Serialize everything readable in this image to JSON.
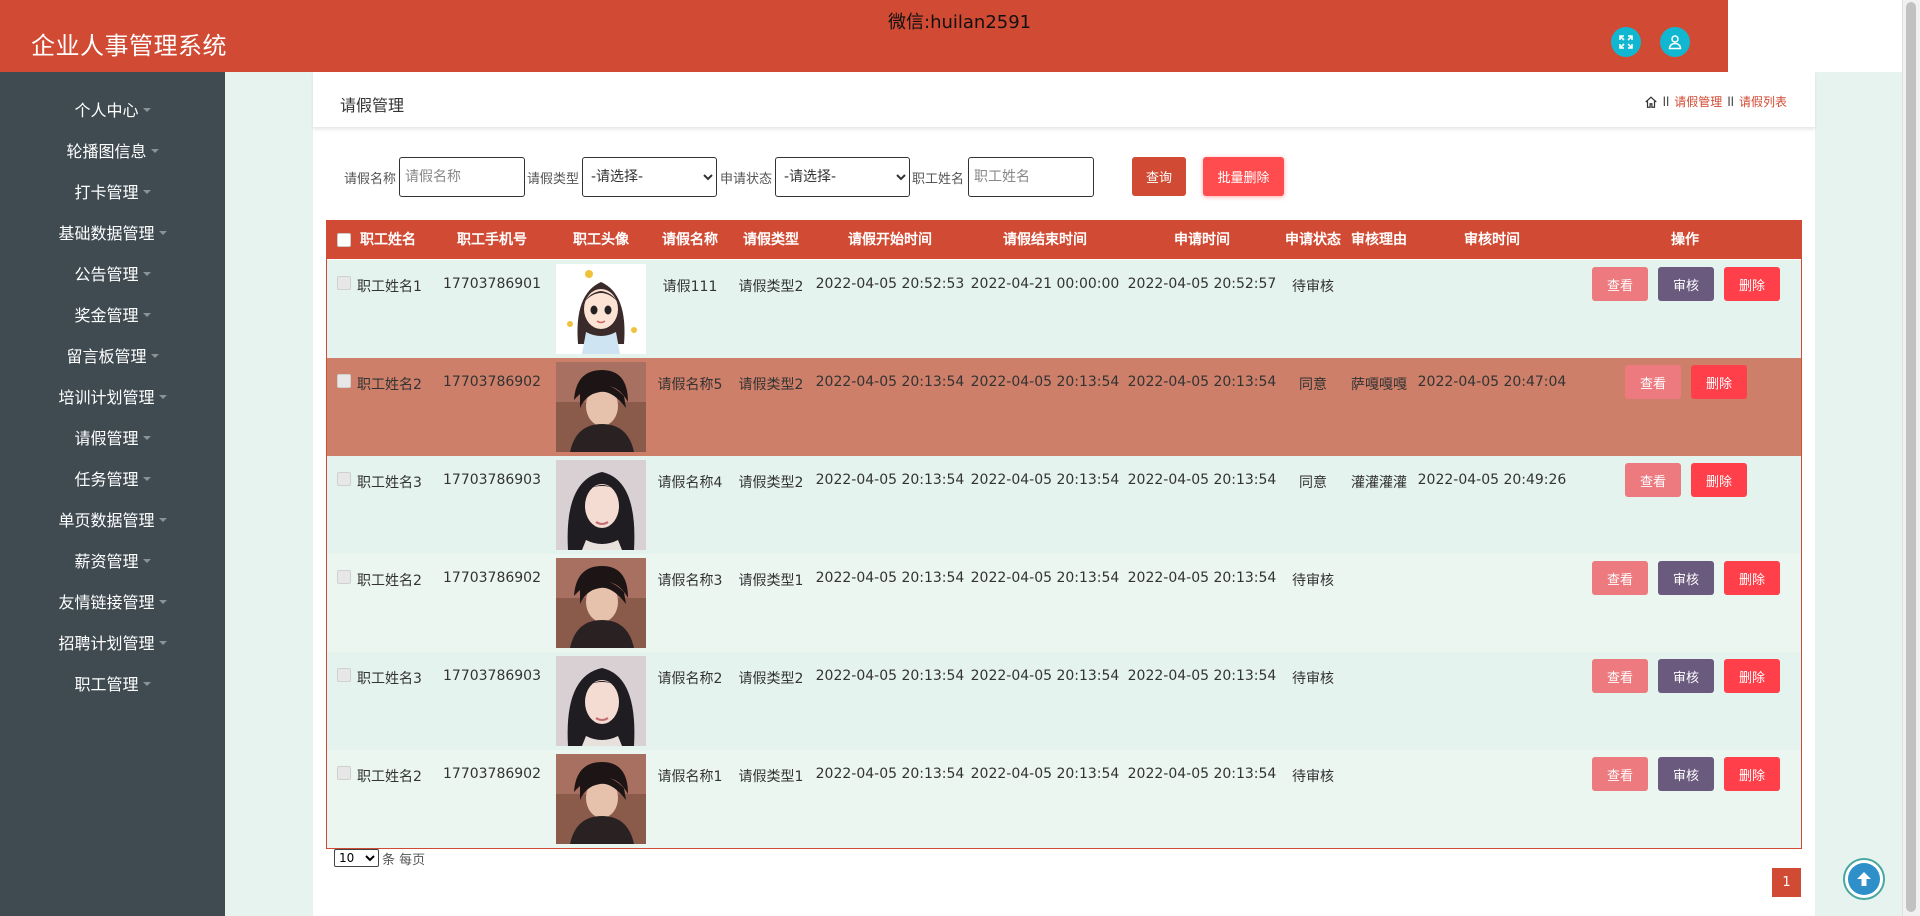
{
  "header": {
    "app_title": "企业人事管理系统",
    "watermark": "微信:huilan2591",
    "fullscreen_icon": "expand-icon",
    "user_icon": "user-icon"
  },
  "sidebar": {
    "items": [
      {
        "label": "个人中心"
      },
      {
        "label": "轮播图信息"
      },
      {
        "label": "打卡管理"
      },
      {
        "label": "基础数据管理"
      },
      {
        "label": "公告管理"
      },
      {
        "label": "奖金管理"
      },
      {
        "label": "留言板管理"
      },
      {
        "label": "培训计划管理"
      },
      {
        "label": "请假管理"
      },
      {
        "label": "任务管理"
      },
      {
        "label": "单页数据管理"
      },
      {
        "label": "薪资管理"
      },
      {
        "label": "友情链接管理"
      },
      {
        "label": "招聘计划管理"
      },
      {
        "label": "职工管理"
      }
    ]
  },
  "page": {
    "title": "请假管理",
    "breadcrumb": [
      "请假管理",
      "请假列表"
    ],
    "breadcrumb_sep": "ll"
  },
  "search": {
    "leave_name_label": "请假名称",
    "leave_name_placeholder": "请假名称",
    "leave_type_label": "请假类型",
    "leave_type_value": "-请选择-",
    "status_label": "申请状态",
    "status_value": "-请选择-",
    "employee_name_label": "职工姓名",
    "employee_name_placeholder": "职工姓名",
    "query_button": "查询",
    "batch_delete_button": "批量删除"
  },
  "table": {
    "columns": [
      "职工姓名",
      "职工手机号",
      "职工头像",
      "请假名称",
      "请假类型",
      "请假开始时间",
      "请假结束时间",
      "申请时间",
      "申请状态",
      "审核理由",
      "审核时间",
      "操作"
    ],
    "rows": [
      {
        "name": "职工姓名1",
        "phone": "17703786901",
        "avatar": "cartoon-girl",
        "leave_name": "请假111",
        "leave_type": "请假类型2",
        "start": "2022-04-05 20:52:53",
        "end": "2022-04-21 00:00:00",
        "apply_time": "2022-04-05 20:52:57",
        "status": "待审核",
        "reason": "",
        "audit_time": "",
        "can_audit": true
      },
      {
        "name": "职工姓名2",
        "phone": "17703786902",
        "avatar": "dark-hair-man",
        "leave_name": "请假名称5",
        "leave_type": "请假类型2",
        "start": "2022-04-05 20:13:54",
        "end": "2022-04-05 20:13:54",
        "apply_time": "2022-04-05 20:13:54",
        "status": "同意",
        "reason": "萨嘎嘎嘎",
        "audit_time": "2022-04-05 20:47:04",
        "can_audit": false
      },
      {
        "name": "职工姓名3",
        "phone": "17703786903",
        "avatar": "long-hair-woman",
        "leave_name": "请假名称4",
        "leave_type": "请假类型2",
        "start": "2022-04-05 20:13:54",
        "end": "2022-04-05 20:13:54",
        "apply_time": "2022-04-05 20:13:54",
        "status": "同意",
        "reason": "灌灌灌灌",
        "audit_time": "2022-04-05 20:49:26",
        "can_audit": false
      },
      {
        "name": "职工姓名2",
        "phone": "17703786902",
        "avatar": "dark-hair-man",
        "leave_name": "请假名称3",
        "leave_type": "请假类型1",
        "start": "2022-04-05 20:13:54",
        "end": "2022-04-05 20:13:54",
        "apply_time": "2022-04-05 20:13:54",
        "status": "待审核",
        "reason": "",
        "audit_time": "",
        "can_audit": true
      },
      {
        "name": "职工姓名3",
        "phone": "17703786903",
        "avatar": "long-hair-woman",
        "leave_name": "请假名称2",
        "leave_type": "请假类型2",
        "start": "2022-04-05 20:13:54",
        "end": "2022-04-05 20:13:54",
        "apply_time": "2022-04-05 20:13:54",
        "status": "待审核",
        "reason": "",
        "audit_time": "",
        "can_audit": true
      },
      {
        "name": "职工姓名2",
        "phone": "17703786902",
        "avatar": "dark-hair-man",
        "leave_name": "请假名称1",
        "leave_type": "请假类型1",
        "start": "2022-04-05 20:13:54",
        "end": "2022-04-05 20:13:54",
        "apply_time": "2022-04-05 20:13:54",
        "status": "待审核",
        "reason": "",
        "audit_time": "",
        "can_audit": true
      }
    ],
    "actions": {
      "view": "查看",
      "audit": "审核",
      "delete": "删除"
    }
  },
  "pagination": {
    "page_size": "10",
    "per_page_label": "条 每页",
    "current_page": "1"
  },
  "colors": {
    "primary": "#d14a33",
    "sidebar": "#3f4b51",
    "highlight_row": "#cd7f69",
    "view_button": "#ec7a7f",
    "audit_button": "#6a5a7e",
    "delete_button": "#ff3f4a"
  }
}
